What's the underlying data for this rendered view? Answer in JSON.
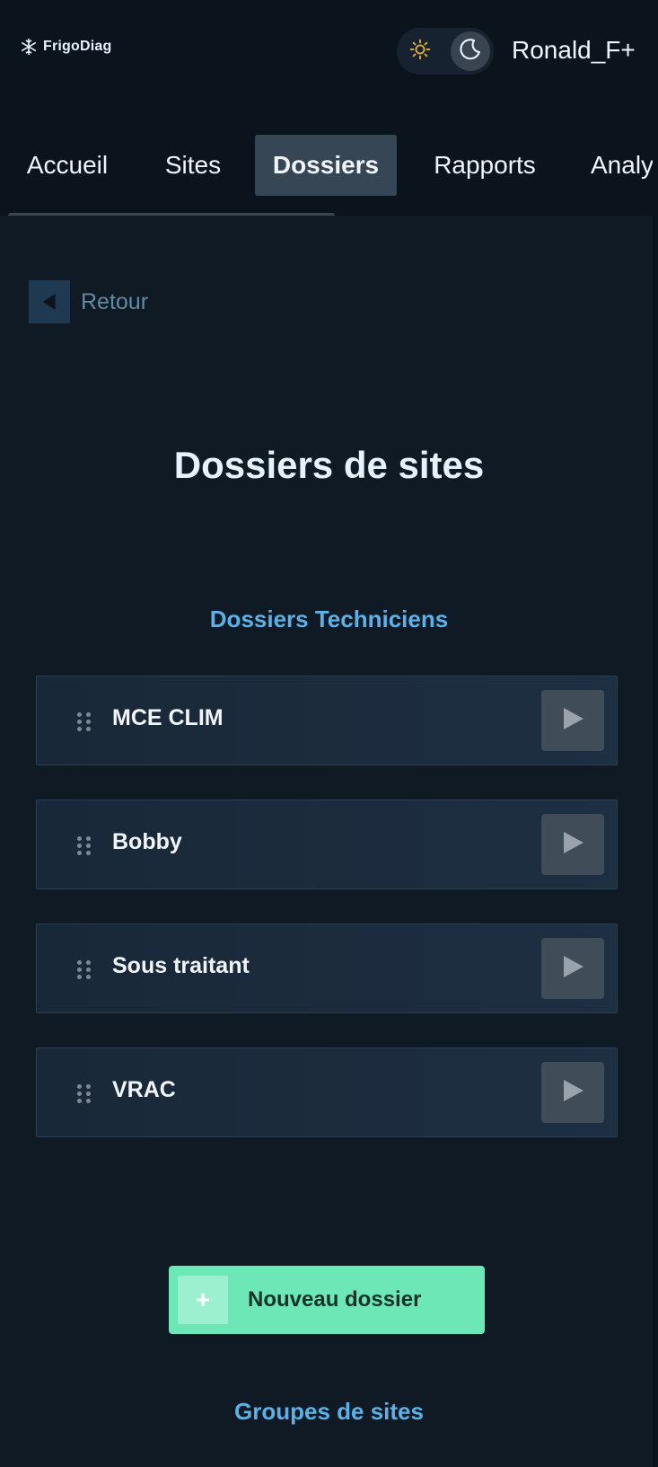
{
  "header": {
    "brand": "FrigoDiag",
    "username": "Ronald_F+"
  },
  "icons": {
    "brand": "snowflake-icon",
    "light": "sun-icon",
    "dark": "moon-icon",
    "back": "back-arrow-icon",
    "drag": "drag-handle-icon",
    "open": "play-icon",
    "plus": "plus-icon"
  },
  "nav": {
    "tabs": [
      {
        "label": "Accueil"
      },
      {
        "label": "Sites"
      },
      {
        "label": "Dossiers",
        "active": true
      },
      {
        "label": "Rapports"
      },
      {
        "label": "Analys"
      }
    ]
  },
  "back": {
    "label": "Retour"
  },
  "page": {
    "title": "Dossiers de sites"
  },
  "sections": {
    "technicians_title": "Dossiers Techniciens",
    "groups_title": "Groupes de sites"
  },
  "folders": [
    {
      "name": "MCE CLIM"
    },
    {
      "name": "Bobby"
    },
    {
      "name": "Sous traitant"
    },
    {
      "name": "VRAC"
    }
  ],
  "actions": {
    "new_folder": "Nouveau dossier",
    "plus_symbol": "+"
  },
  "colors": {
    "accent": "#5bb1e8",
    "primary_button": "#6ee7b7",
    "background": "#0f1a24"
  }
}
